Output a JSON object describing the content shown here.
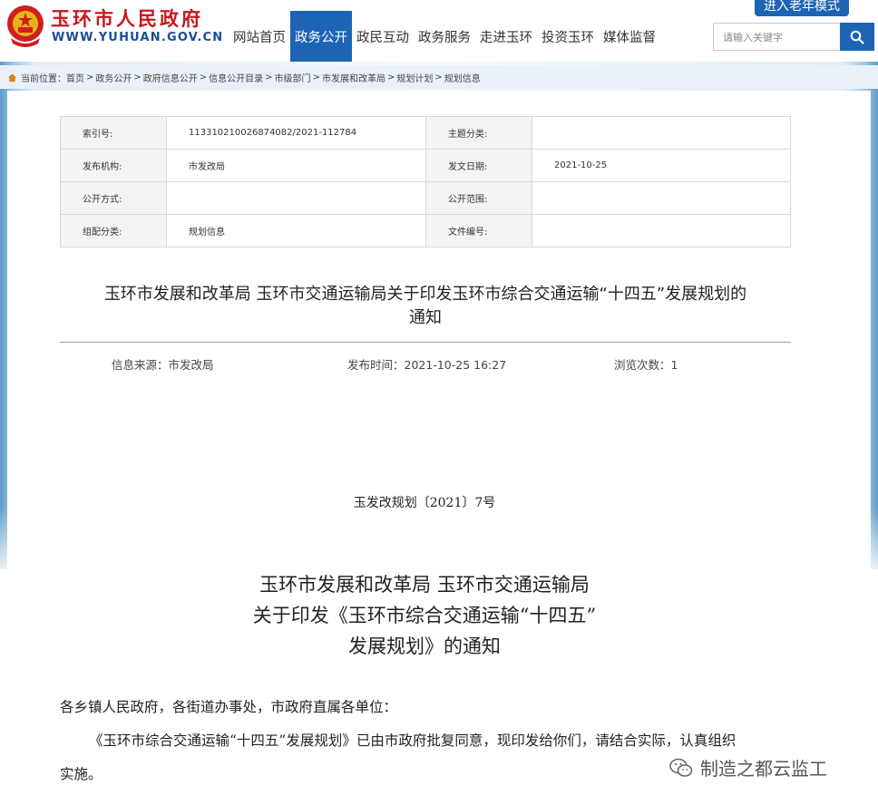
{
  "header": {
    "site_title": "玉环市人民政府",
    "site_url": "WWW.YUHUAN.GOV.CN",
    "elder_mode": "进入老年模式",
    "search_placeholder": "请输入关键字",
    "nav": [
      {
        "label": "网站首页",
        "active": false
      },
      {
        "label": "政务公开",
        "active": true
      },
      {
        "label": "政民互动",
        "active": false
      },
      {
        "label": "政务服务",
        "active": false
      },
      {
        "label": "走进玉环",
        "active": false
      },
      {
        "label": "投资玉环",
        "active": false
      },
      {
        "label": "媒体监督",
        "active": false
      }
    ]
  },
  "breadcrumb": {
    "prefix": "当前位置：",
    "items": [
      "首页",
      "政务公开",
      "政府信息公开",
      "信息公开目录",
      "市级部门",
      "市发展和改革局",
      "规划计划",
      "规划信息"
    ]
  },
  "meta": {
    "index_label": "索引号:",
    "index_value": "113310210026874082/2021-112784",
    "topic_label": "主题分类:",
    "topic_value": "",
    "publisher_label": "发布机构:",
    "publisher_value": "市发改局",
    "date_label": "发文日期:",
    "date_value": "2021-10-25",
    "open_mode_label": "公开方式:",
    "open_mode_value": "",
    "open_scope_label": "公开范围:",
    "open_scope_value": "",
    "category_label": "组配分类:",
    "category_value": "规划信息",
    "file_no_label": "文件编号:",
    "file_no_value": ""
  },
  "article": {
    "title_line1": "玉环市发展和改革局 玉环市交通运输局关于印发玉环市综合交通运输“十四五”发展规划的",
    "title_line2": "通知",
    "source_label": "信息来源：",
    "source_value": "市发改局",
    "time_label": "发布时间：",
    "time_value": "2021-10-25 16:27",
    "views_label": "浏览次数：",
    "views_value": "1",
    "doc_number": "玉发改规划〔2021〕7号",
    "notice_line1": "玉环市发展和改革局  玉环市交通运输局",
    "notice_line2": "关于印发《玉环市综合交通运输“十四五”",
    "notice_line3": "发展规划》的通知",
    "salutation": "各乡镇人民政府，各街道办事处，市政府直属各单位：",
    "para1_line1": "《玉环市综合交通运输“十四五”发展规划》已由市政府批复同意，现印发给你们，请结合实际，认真组织",
    "para1_line2": "实施。"
  },
  "watermark": {
    "text": "制造之都云监工"
  },
  "colors": {
    "brand_red": "#c8161d",
    "brand_blue": "#1e64b4"
  }
}
